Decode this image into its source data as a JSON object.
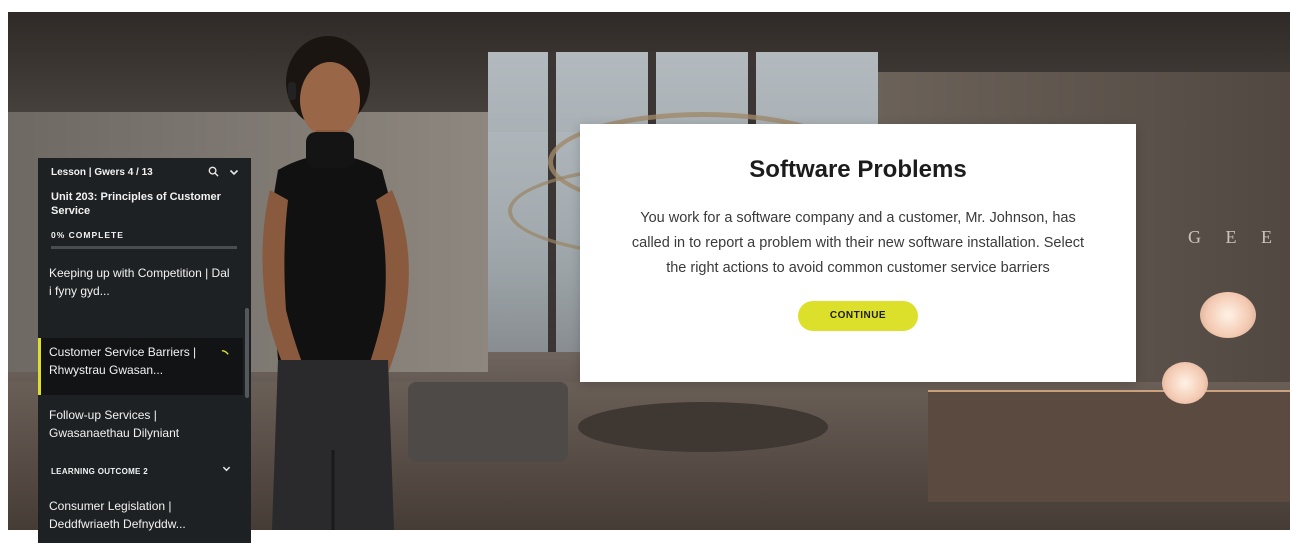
{
  "sidebar": {
    "lesson_label": "Lesson | Gwers 4 / 13",
    "unit_title": "Unit 203: Principles of Customer Service",
    "progress_label": "0% COMPLETE",
    "progress": 0,
    "items": [
      {
        "label": "Keeping up with Competition | Dal i fyny gyd..."
      },
      {
        "label": "Customer Service Barriers | Rhwystrau Gwasan..."
      },
      {
        "label": "Follow-up Services | Gwasanaethau Dilyniant"
      },
      {
        "label": "Consumer Legislation | Deddfwriaeth Defnyddw..."
      }
    ],
    "section_label": "LEARNING OUTCOME 2",
    "icons": [
      "search-icon",
      "chevron-down-icon"
    ]
  },
  "card": {
    "title": "Software Problems",
    "body": "You work for a software company and a customer, Mr. Johnson, has called in to report a problem with their new software installation. Select the right actions to avoid common customer service barriers",
    "button_label": "CONTINUE"
  },
  "background": {
    "sign_text": "G E E"
  },
  "colors": {
    "accent": "#dde02a",
    "sidebar_bg": "#1e2124",
    "card_bg": "#ffffff"
  }
}
